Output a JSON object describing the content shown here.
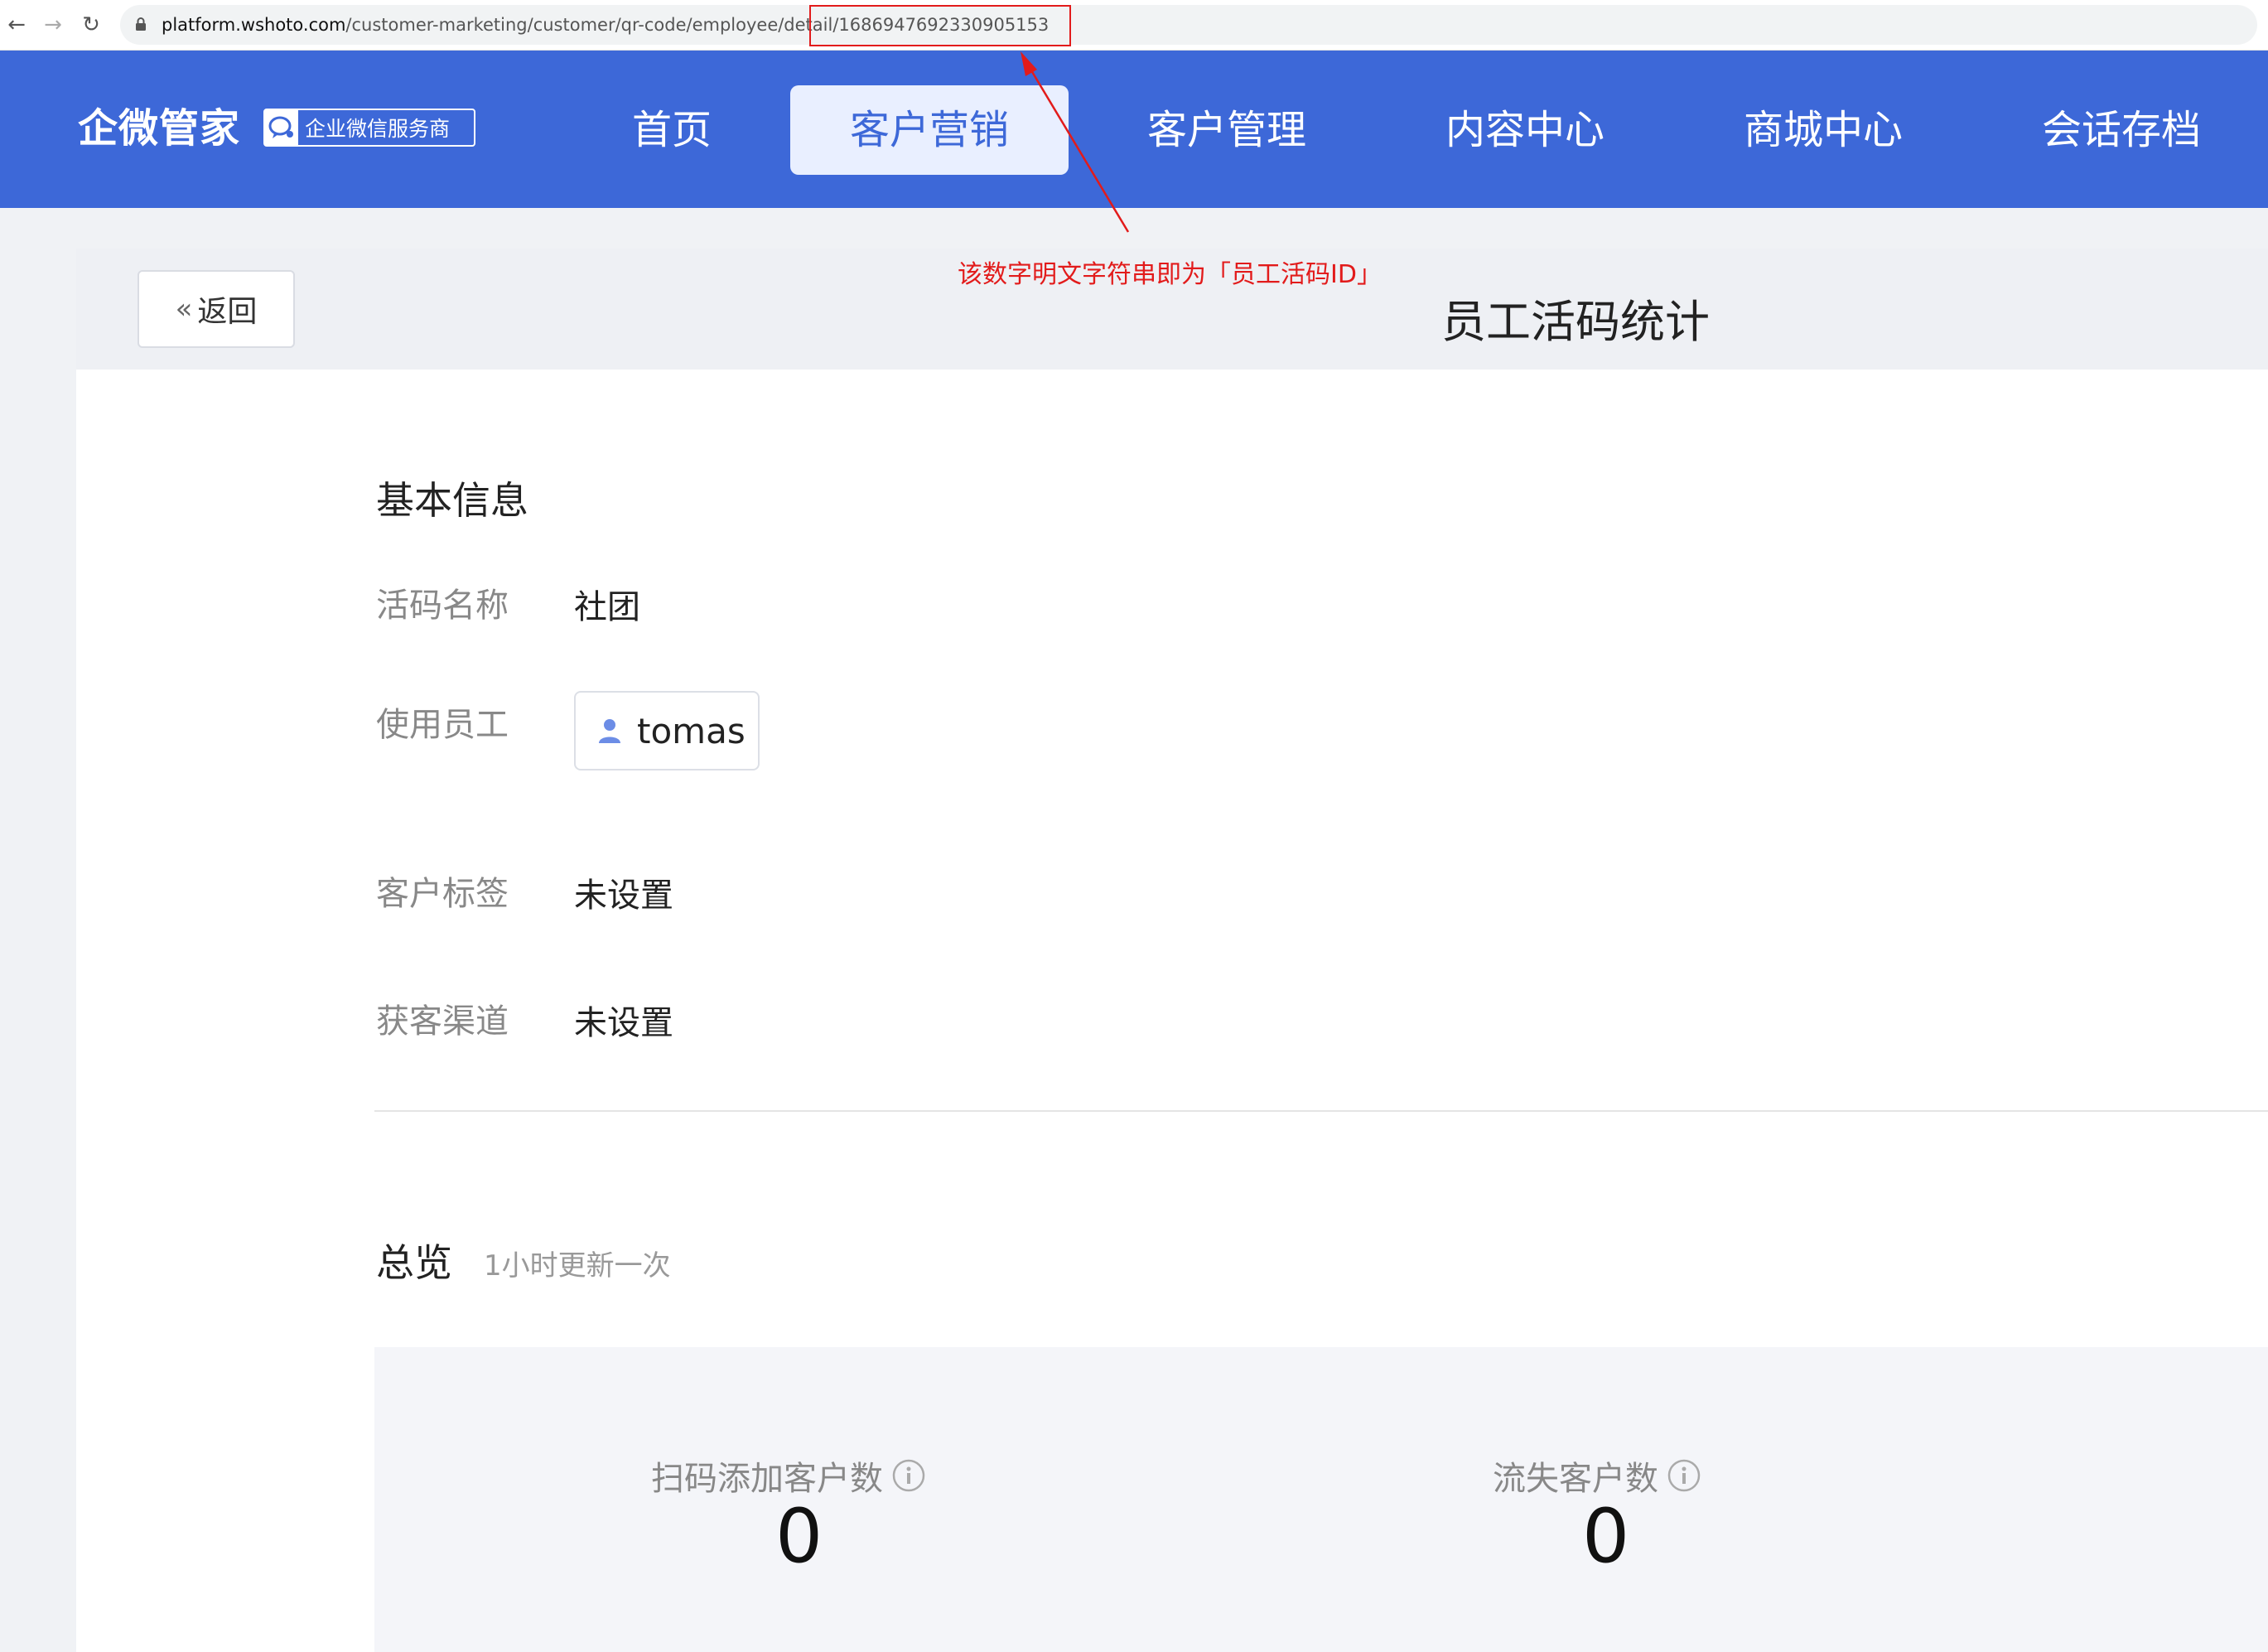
{
  "browser": {
    "url_host": "platform.wshoto.com",
    "url_path": "/customer-marketing/customer/qr-code/employee/detail/1686947692330905153"
  },
  "header": {
    "logo": "企微管家",
    "badge": "企业微信服务商",
    "nav": [
      {
        "label": "首页",
        "active": false
      },
      {
        "label": "客户营销",
        "active": true
      },
      {
        "label": "客户管理",
        "active": false
      },
      {
        "label": "内容中心",
        "active": false
      },
      {
        "label": "商城中心",
        "active": false
      },
      {
        "label": "会话存档",
        "active": false
      }
    ]
  },
  "annotation": {
    "text": "该数字明文字符串即为「员工活码ID」",
    "color": "#e21b1b"
  },
  "page": {
    "back_label": "返回",
    "title": "员工活码统计"
  },
  "basic_info": {
    "title": "基本信息",
    "fields": [
      {
        "label": "活码名称",
        "value": "社团"
      },
      {
        "label": "使用员工",
        "value": "tomas"
      },
      {
        "label": "客户标签",
        "value": "未设置"
      },
      {
        "label": "获客渠道",
        "value": "未设置"
      }
    ]
  },
  "overview": {
    "title": "总览",
    "subtitle": "1小时更新一次",
    "stats": [
      {
        "label": "扫码添加客户数",
        "value": "0"
      },
      {
        "label": "流失客户数",
        "value": "0"
      }
    ]
  },
  "colors": {
    "brand": "#3d68d8",
    "active_nav_bg": "#e9efff"
  }
}
